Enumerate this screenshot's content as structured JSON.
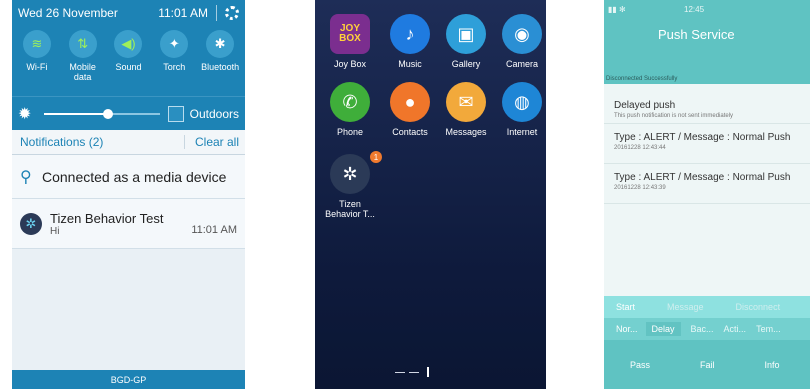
{
  "screen1": {
    "status": {
      "date": "Wed 26 November",
      "time": "11:01 AM",
      "settings_icon": "gear-icon"
    },
    "quick_settings": [
      {
        "label": "Wi-Fi",
        "icon": "wifi-icon",
        "glyph": "≋",
        "active": true
      },
      {
        "label": "Mobile data",
        "icon": "mobile-data-icon",
        "glyph": "⇅",
        "active": true
      },
      {
        "label": "Sound",
        "icon": "sound-icon",
        "glyph": "◀)",
        "active": true
      },
      {
        "label": "Torch",
        "icon": "torch-icon",
        "glyph": "✦",
        "active": false
      },
      {
        "label": "Bluetooth",
        "icon": "bluetooth-icon",
        "glyph": "✱",
        "active": false
      }
    ],
    "brightness": {
      "level": 0.55,
      "outdoors_label": "Outdoors"
    },
    "notifications_header": {
      "title": "Notifications (2)",
      "clear_label": "Clear all"
    },
    "notification_usb": {
      "text": "Connected as a media device"
    },
    "notification_app": {
      "title": "Tizen Behavior Test",
      "body": "Hi",
      "time": "11:01 AM"
    },
    "carrier": "BGD-GP",
    "accent": "#1d83b5"
  },
  "screen2": {
    "apps": [
      {
        "label": "Joy Box",
        "icon": "joy-box-icon",
        "glyph": "JOY BOX",
        "color": "#7b2e8f"
      },
      {
        "label": "Music",
        "icon": "music-icon",
        "glyph": "♪",
        "color": "#1f7be0"
      },
      {
        "label": "Gallery",
        "icon": "gallery-icon",
        "glyph": "▣",
        "color": "#2e9fd9"
      },
      {
        "label": "Camera",
        "icon": "camera-icon",
        "glyph": "◉",
        "color": "#2a8fd4"
      },
      {
        "label": "Phone",
        "icon": "phone-icon",
        "glyph": "✆",
        "color": "#3fae3a"
      },
      {
        "label": "Contacts",
        "icon": "contacts-icon",
        "glyph": "●",
        "color": "#f0762a"
      },
      {
        "label": "Messages",
        "icon": "messages-icon",
        "glyph": "✉",
        "color": "#f2a93b"
      },
      {
        "label": "Internet",
        "icon": "internet-icon",
        "glyph": "◍",
        "color": "#1e86d6"
      },
      {
        "label": "Tizen Behavior T...",
        "icon": "tizen-behavior-test-icon",
        "glyph": "✲",
        "color": "#2b3a57",
        "badge": "1"
      }
    ]
  },
  "screen3": {
    "status_time": "12:45",
    "title": "Push Service",
    "status_message": "Disconnected Successfully",
    "items": [
      {
        "title": "Delayed push",
        "subtitle": "This push notification is not sent immediately"
      },
      {
        "title": "Type : ALERT / Message : Normal Push",
        "subtitle": "20161228 12:43:44"
      },
      {
        "title": "Type : ALERT / Message : Normal Push",
        "subtitle": "20161228 12:43:39"
      }
    ],
    "row1": [
      "Start",
      "Message",
      "Disconnect"
    ],
    "row2": [
      "Nor...",
      "Delay",
      "Bac...",
      "Acti...",
      "Tem..."
    ],
    "row3": [
      "Pass",
      "Fail",
      "Info"
    ],
    "accent": "#5fc3c2"
  }
}
